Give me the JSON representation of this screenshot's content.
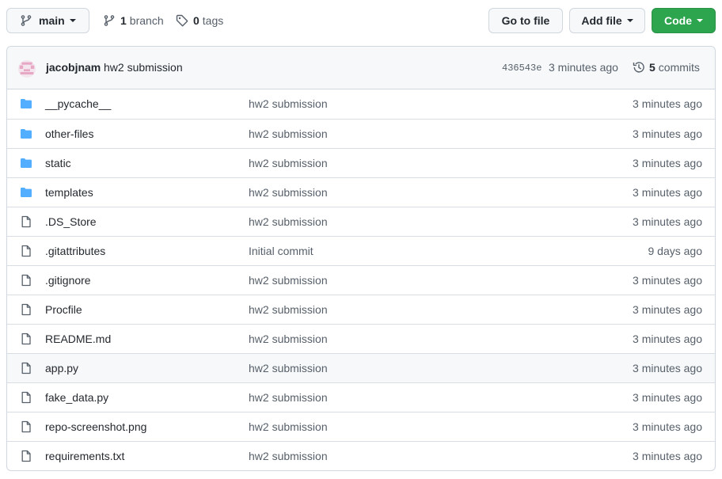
{
  "toolbar": {
    "branch_button": "main",
    "branch_count": "1",
    "branch_label": "branch",
    "tag_count": "0",
    "tag_label": "tags",
    "go_to_file": "Go to file",
    "add_file": "Add file",
    "code": "Code"
  },
  "latest_commit": {
    "author": "jacobjnam",
    "message": "hw2 submission",
    "sha": "436543e",
    "time": "3 minutes ago",
    "commit_count": "5",
    "commit_label": "commits"
  },
  "colors": {
    "folder": "#54aeff",
    "file_icon": "#57606a",
    "code_button": "#2da44e",
    "avatar": "#e6a8c4"
  },
  "files": [
    {
      "name": "__pycache__",
      "type": "folder",
      "message": "hw2 submission",
      "age": "3 minutes ago"
    },
    {
      "name": "other-files",
      "type": "folder",
      "message": "hw2 submission",
      "age": "3 minutes ago"
    },
    {
      "name": "static",
      "type": "folder",
      "message": "hw2 submission",
      "age": "3 minutes ago"
    },
    {
      "name": "templates",
      "type": "folder",
      "message": "hw2 submission",
      "age": "3 minutes ago"
    },
    {
      "name": ".DS_Store",
      "type": "file",
      "message": "hw2 submission",
      "age": "3 minutes ago"
    },
    {
      "name": ".gitattributes",
      "type": "file",
      "message": "Initial commit",
      "age": "9 days ago"
    },
    {
      "name": ".gitignore",
      "type": "file",
      "message": "hw2 submission",
      "age": "3 minutes ago"
    },
    {
      "name": "Procfile",
      "type": "file",
      "message": "hw2 submission",
      "age": "3 minutes ago"
    },
    {
      "name": "README.md",
      "type": "file",
      "message": "hw2 submission",
      "age": "3 minutes ago"
    },
    {
      "name": "app.py",
      "type": "file",
      "message": "hw2 submission",
      "age": "3 minutes ago"
    },
    {
      "name": "fake_data.py",
      "type": "file",
      "message": "hw2 submission",
      "age": "3 minutes ago"
    },
    {
      "name": "repo-screenshot.png",
      "type": "file",
      "message": "hw2 submission",
      "age": "3 minutes ago"
    },
    {
      "name": "requirements.txt",
      "type": "file",
      "message": "hw2 submission",
      "age": "3 minutes ago"
    }
  ]
}
